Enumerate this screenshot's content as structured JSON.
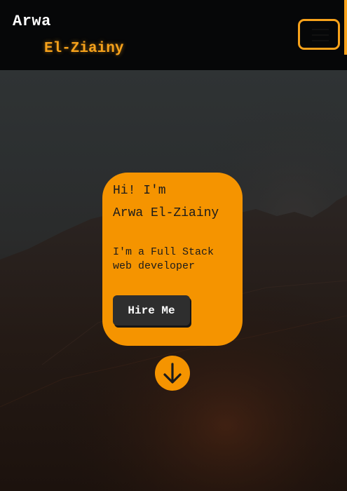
{
  "header": {
    "brand_first": "Arwa",
    "brand_last": "El-Ziainy",
    "menu_icon": "hamburger-menu-icon"
  },
  "hero": {
    "greeting": "Hi! I'm",
    "name": "Arwa El-Ziainy",
    "tagline": "I'm a Full Stack web developer",
    "cta_label": "Hire Me",
    "scroll_icon": "arrow-down-icon"
  },
  "colors": {
    "accent": "#f59400",
    "brand_accent": "#f7a21b",
    "navbar_bg": "#060708",
    "button_bg": "#2e2e2e"
  }
}
